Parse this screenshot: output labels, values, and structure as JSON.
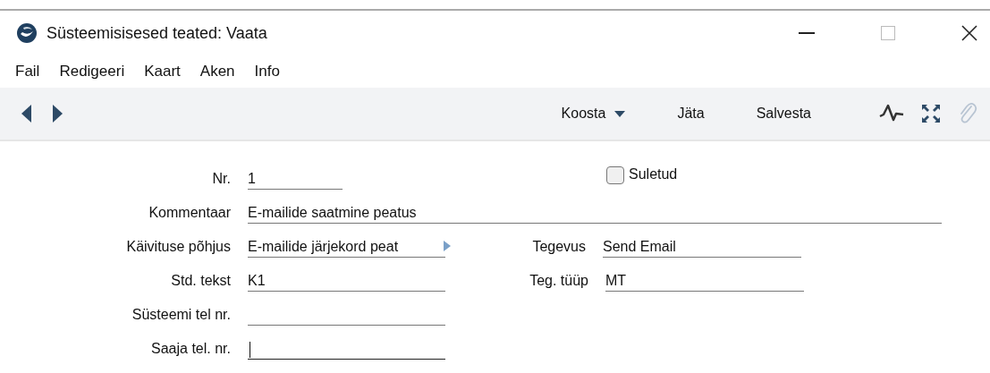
{
  "window": {
    "title": "Süsteemisisesed teated: Vaata"
  },
  "menu": [
    "Fail",
    "Redigeeri",
    "Kaart",
    "Aken",
    "Info"
  ],
  "toolbar": {
    "buttons": [
      {
        "label": "Koosta",
        "kind": "dropdown"
      },
      {
        "label": "Jäta",
        "kind": "plain"
      },
      {
        "label": "Salvesta",
        "kind": "plain"
      }
    ]
  },
  "form": {
    "nr": {
      "label": "Nr.",
      "value": "1"
    },
    "closed": {
      "label": "Suletud",
      "checked": false
    },
    "comment": {
      "label": "Kommentaar",
      "value": "E-mailide saatmine peatus"
    },
    "rows": [
      {
        "label": "Käivituse põhjus",
        "value": "E-mailide järjekord peat",
        "has_link": true,
        "focused": false,
        "right": {
          "label": "Tegevus",
          "value": "Send Email"
        }
      },
      {
        "label": "Std. tekst",
        "value": "K1",
        "has_link": false,
        "focused": false,
        "right": {
          "label": "Teg. tüüp",
          "value": "MT"
        }
      },
      {
        "label": "Süsteemi tel nr.",
        "value": "",
        "has_link": false,
        "focused": false
      },
      {
        "label": "Saaja tel. nr.",
        "value": "",
        "has_link": false,
        "focused": true
      }
    ]
  }
}
